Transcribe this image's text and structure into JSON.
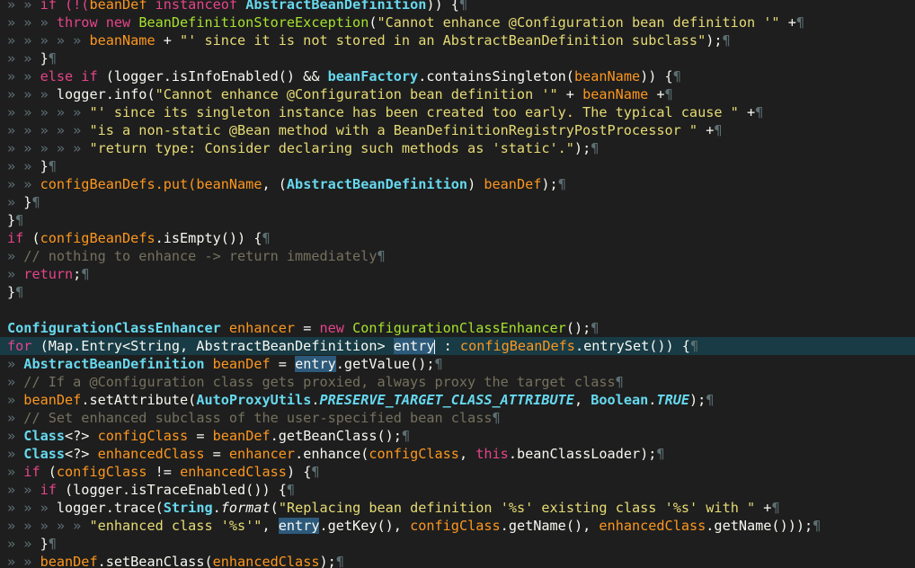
{
  "editor": {
    "language": "java",
    "current_line_index": 19,
    "lines": [
      [
        {
          "t": "» » ",
          "c": "ws"
        },
        {
          "t": "if (!(",
          "c": "kw"
        },
        {
          "t": "beanDef ",
          "c": "field"
        },
        {
          "t": "instanceof ",
          "c": "kw"
        },
        {
          "t": "AbstractBeanDefinition",
          "c": "type"
        },
        {
          "t": ")) {",
          "c": "plain"
        },
        {
          "t": "¶",
          "c": "ws"
        }
      ],
      [
        {
          "t": "» » » ",
          "c": "ws"
        },
        {
          "t": "throw new ",
          "c": "kw"
        },
        {
          "t": "BeanDefinitionStoreException",
          "c": "cls"
        },
        {
          "t": "(",
          "c": "plain"
        },
        {
          "t": "\"Cannot enhance @Configuration bean definition '\"",
          "c": "str"
        },
        {
          "t": " +",
          "c": "plain"
        },
        {
          "t": "¶",
          "c": "ws"
        }
      ],
      [
        {
          "t": "» » » » » ",
          "c": "ws"
        },
        {
          "t": "beanName",
          "c": "field"
        },
        {
          "t": " + ",
          "c": "plain"
        },
        {
          "t": "\"' since it is not stored in an AbstractBeanDefinition subclass\"",
          "c": "str"
        },
        {
          "t": ");",
          "c": "plain"
        },
        {
          "t": "¶",
          "c": "ws"
        }
      ],
      [
        {
          "t": "» » ",
          "c": "ws"
        },
        {
          "t": "}",
          "c": "plain"
        },
        {
          "t": "¶",
          "c": "ws"
        }
      ],
      [
        {
          "t": "» » ",
          "c": "ws"
        },
        {
          "t": "else if ",
          "c": "kw"
        },
        {
          "t": "(logger.isInfoEnabled() && ",
          "c": "plain"
        },
        {
          "t": "beanFactory",
          "c": "type"
        },
        {
          "t": ".containsSingleton(",
          "c": "plain"
        },
        {
          "t": "beanName",
          "c": "field"
        },
        {
          "t": ")) {",
          "c": "plain"
        },
        {
          "t": "¶",
          "c": "ws"
        }
      ],
      [
        {
          "t": "» » » ",
          "c": "ws"
        },
        {
          "t": "logger.info(",
          "c": "plain"
        },
        {
          "t": "\"Cannot enhance @Configuration bean definition '\"",
          "c": "str"
        },
        {
          "t": " + ",
          "c": "plain"
        },
        {
          "t": "beanName",
          "c": "field"
        },
        {
          "t": " +",
          "c": "plain"
        },
        {
          "t": "¶",
          "c": "ws"
        }
      ],
      [
        {
          "t": "» » » » » ",
          "c": "ws"
        },
        {
          "t": "\"' since its singleton instance has been created too early. The typical cause \"",
          "c": "str"
        },
        {
          "t": " +",
          "c": "plain"
        },
        {
          "t": "¶",
          "c": "ws"
        }
      ],
      [
        {
          "t": "» » » » » ",
          "c": "ws"
        },
        {
          "t": "\"is a non-static @Bean method with a BeanDefinitionRegistryPostProcessor \"",
          "c": "str"
        },
        {
          "t": " +",
          "c": "plain"
        },
        {
          "t": "¶",
          "c": "ws"
        }
      ],
      [
        {
          "t": "» » » » » ",
          "c": "ws"
        },
        {
          "t": "\"return type: Consider declaring such methods as 'static'.\"",
          "c": "str"
        },
        {
          "t": ");",
          "c": "plain"
        },
        {
          "t": "¶",
          "c": "ws"
        }
      ],
      [
        {
          "t": "» » ",
          "c": "ws"
        },
        {
          "t": "}",
          "c": "plain"
        },
        {
          "t": "¶",
          "c": "ws"
        }
      ],
      [
        {
          "t": "» » ",
          "c": "ws"
        },
        {
          "t": "configBeanDefs.put(",
          "c": "field"
        },
        {
          "t": "beanName",
          "c": "field"
        },
        {
          "t": ", (",
          "c": "plain"
        },
        {
          "t": "AbstractBeanDefinition",
          "c": "type"
        },
        {
          "t": ") ",
          "c": "plain"
        },
        {
          "t": "beanDef",
          "c": "field"
        },
        {
          "t": ");",
          "c": "plain"
        },
        {
          "t": "¶",
          "c": "ws"
        }
      ],
      [
        {
          "t": "» ",
          "c": "ws"
        },
        {
          "t": "}",
          "c": "plain"
        },
        {
          "t": "¶",
          "c": "ws"
        }
      ],
      [
        {
          "t": "}",
          "c": "plain"
        },
        {
          "t": "¶",
          "c": "ws"
        }
      ],
      [
        {
          "t": "if ",
          "c": "kw"
        },
        {
          "t": "(",
          "c": "plain"
        },
        {
          "t": "configBeanDefs",
          "c": "field"
        },
        {
          "t": ".isEmpty()) {",
          "c": "plain"
        },
        {
          "t": "¶",
          "c": "ws"
        }
      ],
      [
        {
          "t": "» ",
          "c": "ws"
        },
        {
          "t": "// nothing to enhance -> return immediately",
          "c": "cmt"
        },
        {
          "t": "¶",
          "c": "ws"
        }
      ],
      [
        {
          "t": "» ",
          "c": "ws"
        },
        {
          "t": "return",
          "c": "kw"
        },
        {
          "t": ";",
          "c": "plain"
        },
        {
          "t": "¶",
          "c": "ws"
        }
      ],
      [
        {
          "t": "}",
          "c": "plain"
        },
        {
          "t": "¶",
          "c": "ws"
        }
      ],
      [],
      [
        {
          "t": "ConfigurationClassEnhancer ",
          "c": "type"
        },
        {
          "t": "enhancer",
          "c": "field"
        },
        {
          "t": " = ",
          "c": "plain"
        },
        {
          "t": "new ",
          "c": "kw"
        },
        {
          "t": "ConfigurationClassEnhancer",
          "c": "cls"
        },
        {
          "t": "();",
          "c": "plain"
        },
        {
          "t": "¶",
          "c": "ws"
        }
      ],
      [
        {
          "t": "for ",
          "c": "kw"
        },
        {
          "t": "(Map.Entry<String, AbstractBeanDefinition> ",
          "c": "plain"
        },
        {
          "t": "entry",
          "c": "hl"
        },
        {
          "t": "CARET",
          "c": "caret"
        },
        {
          "t": " : ",
          "c": "plain"
        },
        {
          "t": "configBeanDefs",
          "c": "field"
        },
        {
          "t": ".entrySet()) {",
          "c": "plain"
        },
        {
          "t": "¶",
          "c": "ws"
        }
      ],
      [
        {
          "t": "» ",
          "c": "ws"
        },
        {
          "t": "AbstractBeanDefinition ",
          "c": "type"
        },
        {
          "t": "beanDef",
          "c": "field"
        },
        {
          "t": " = ",
          "c": "plain"
        },
        {
          "t": "entry",
          "c": "hl"
        },
        {
          "t": ".getValue();",
          "c": "plain"
        },
        {
          "t": "¶",
          "c": "ws"
        }
      ],
      [
        {
          "t": "» ",
          "c": "ws"
        },
        {
          "t": "// If a @Configuration class gets proxied, always proxy the target class",
          "c": "cmt"
        },
        {
          "t": "¶",
          "c": "ws"
        }
      ],
      [
        {
          "t": "» ",
          "c": "ws"
        },
        {
          "t": "beanDef",
          "c": "field"
        },
        {
          "t": ".setAttribute(",
          "c": "plain"
        },
        {
          "t": "AutoProxyUtils",
          "c": "type"
        },
        {
          "t": ".",
          "c": "plain"
        },
        {
          "t": "PRESERVE_TARGET_CLASS_ATTRIBUTE",
          "c": "const"
        },
        {
          "t": ", ",
          "c": "plain"
        },
        {
          "t": "Boolean",
          "c": "type"
        },
        {
          "t": ".",
          "c": "plain"
        },
        {
          "t": "TRUE",
          "c": "const"
        },
        {
          "t": ");",
          "c": "plain"
        },
        {
          "t": "¶",
          "c": "ws"
        }
      ],
      [
        {
          "t": "» ",
          "c": "ws"
        },
        {
          "t": "// Set enhanced subclass of the user-specified bean class",
          "c": "cmt"
        },
        {
          "t": "¶",
          "c": "ws"
        }
      ],
      [
        {
          "t": "» ",
          "c": "ws"
        },
        {
          "t": "Class",
          "c": "type"
        },
        {
          "t": "<?> ",
          "c": "plain"
        },
        {
          "t": "configClass",
          "c": "field"
        },
        {
          "t": " = ",
          "c": "plain"
        },
        {
          "t": "beanDef",
          "c": "field"
        },
        {
          "t": ".getBeanClass();",
          "c": "plain"
        },
        {
          "t": "¶",
          "c": "ws"
        }
      ],
      [
        {
          "t": "» ",
          "c": "ws"
        },
        {
          "t": "Class",
          "c": "type"
        },
        {
          "t": "<?> ",
          "c": "plain"
        },
        {
          "t": "enhancedClass",
          "c": "field"
        },
        {
          "t": " = ",
          "c": "plain"
        },
        {
          "t": "enhancer",
          "c": "field"
        },
        {
          "t": ".enhance(",
          "c": "plain"
        },
        {
          "t": "configClass",
          "c": "field"
        },
        {
          "t": ", ",
          "c": "plain"
        },
        {
          "t": "this",
          "c": "kw"
        },
        {
          "t": ".beanClassLoader);",
          "c": "plain"
        },
        {
          "t": "¶",
          "c": "ws"
        }
      ],
      [
        {
          "t": "» ",
          "c": "ws"
        },
        {
          "t": "if ",
          "c": "kw"
        },
        {
          "t": "(",
          "c": "plain"
        },
        {
          "t": "configClass",
          "c": "field"
        },
        {
          "t": " != ",
          "c": "plain"
        },
        {
          "t": "enhancedClass",
          "c": "field"
        },
        {
          "t": ") {",
          "c": "plain"
        },
        {
          "t": "¶",
          "c": "ws"
        }
      ],
      [
        {
          "t": "» » ",
          "c": "ws"
        },
        {
          "t": "if ",
          "c": "kw"
        },
        {
          "t": "(logger.isTraceEnabled()) {",
          "c": "plain"
        },
        {
          "t": "¶",
          "c": "ws"
        }
      ],
      [
        {
          "t": "» » » ",
          "c": "ws"
        },
        {
          "t": "logger.trace(",
          "c": "plain"
        },
        {
          "t": "String",
          "c": "type"
        },
        {
          "t": ".",
          "c": "plain"
        },
        {
          "t": "format",
          "c": "mth"
        },
        {
          "t": "(",
          "c": "plain"
        },
        {
          "t": "\"Replacing bean definition '%s' existing class '%s' with \"",
          "c": "str"
        },
        {
          "t": " +",
          "c": "plain"
        },
        {
          "t": "¶",
          "c": "ws"
        }
      ],
      [
        {
          "t": "» » » » » ",
          "c": "ws"
        },
        {
          "t": "\"enhanced class '%s'\"",
          "c": "str"
        },
        {
          "t": ", ",
          "c": "plain"
        },
        {
          "t": "entry",
          "c": "hl"
        },
        {
          "t": ".getKey(), ",
          "c": "plain"
        },
        {
          "t": "configClass",
          "c": "field"
        },
        {
          "t": ".getName(), ",
          "c": "plain"
        },
        {
          "t": "enhancedClass",
          "c": "field"
        },
        {
          "t": ".getName()));",
          "c": "plain"
        },
        {
          "t": "¶",
          "c": "ws"
        }
      ],
      [
        {
          "t": "» » ",
          "c": "ws"
        },
        {
          "t": "}",
          "c": "plain"
        },
        {
          "t": "¶",
          "c": "ws"
        }
      ],
      [
        {
          "t": "» » ",
          "c": "ws"
        },
        {
          "t": "beanDef",
          "c": "field"
        },
        {
          "t": ".setBeanClass(",
          "c": "plain"
        },
        {
          "t": "enhancedClass",
          "c": "field"
        },
        {
          "t": ");",
          "c": "plain"
        },
        {
          "t": "¶",
          "c": "ws"
        }
      ]
    ]
  }
}
